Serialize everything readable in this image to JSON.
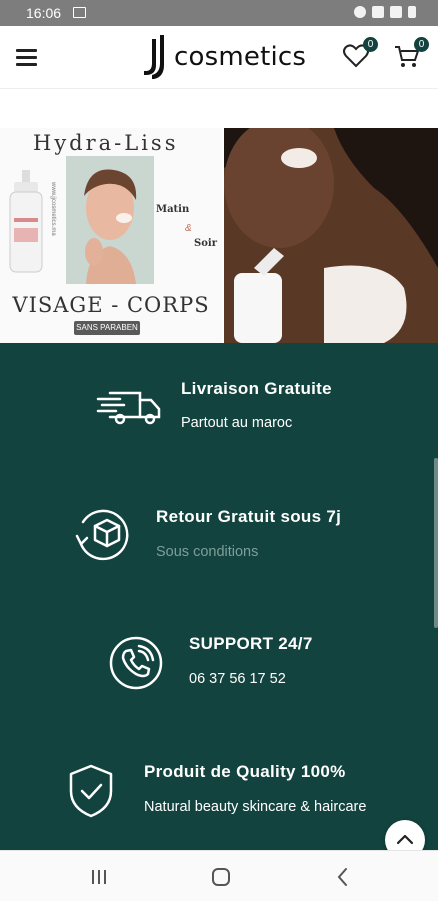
{
  "status_bar": {
    "time": "16:06"
  },
  "header": {
    "logo_text": "cosmetics",
    "wishlist_count": "0",
    "cart_count": "0"
  },
  "banner": {
    "title": "Hydra-Liss",
    "matin": "Matin",
    "ampersand": "&",
    "soir": "Soir",
    "side_text": "www.jjcosmetics.ma",
    "visage_corps": "VISAGE - CORPS",
    "paraben": "SANS PARABEN"
  },
  "features": [
    {
      "title": "Livraison Gratuite",
      "subtitle": "Partout au maroc",
      "icon": "delivery-truck-icon"
    },
    {
      "title": "Retour Gratuit sous 7j",
      "subtitle": "Sous conditions",
      "icon": "return-box-icon"
    },
    {
      "title": "SUPPORT 24/7",
      "subtitle": "06 37 56 17 52",
      "icon": "phone-icon"
    },
    {
      "title": "Produit de Quality 100%",
      "subtitle": "Natural beauty skincare & haircare",
      "icon": "shield-check-icon"
    }
  ],
  "colors": {
    "brand_green": "#12433f",
    "white": "#ffffff"
  }
}
